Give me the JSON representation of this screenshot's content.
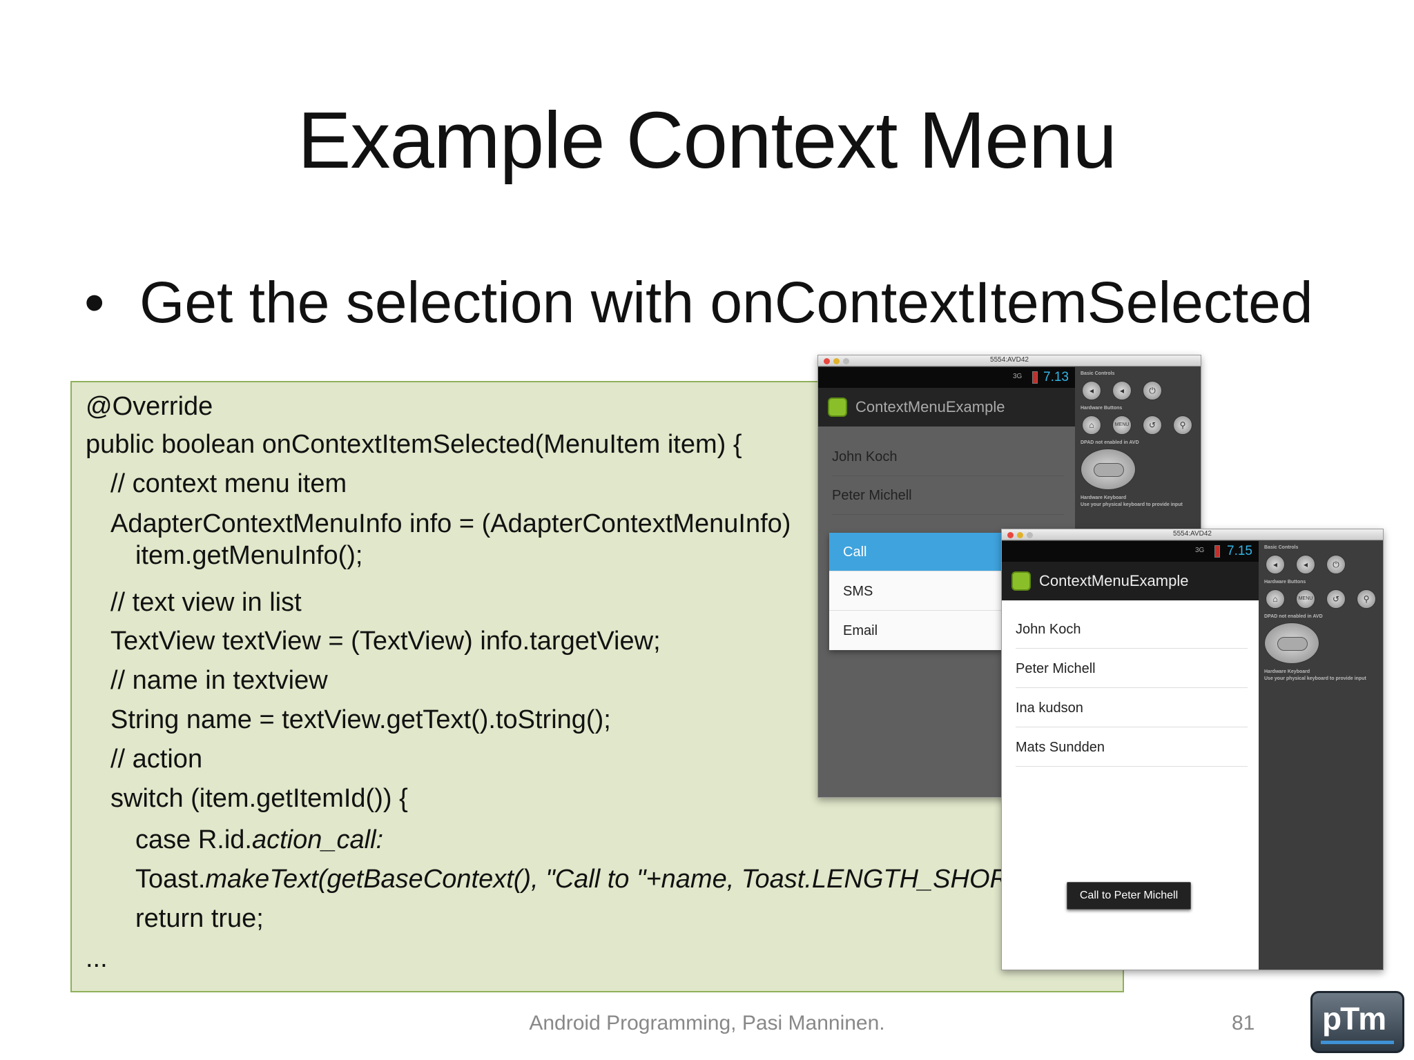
{
  "title": "Example Context Menu",
  "bullet": {
    "dot": "•",
    "text": "Get the selection with onContextItemSelected"
  },
  "code": [
    "@Override",
    "public boolean onContextItemSelected(MenuItem item) {",
    "// context menu item",
    "AdapterContextMenuInfo info = (AdapterContextMenuInfo)",
    "item.getMenuInfo();",
    "// text view in list",
    "TextView textView = (TextView) info.targetView;",
    "// name in textview",
    "String name = textView.getText().toString();",
    "// action",
    "switch (item.getItemId()) {",
    "case R.id.",
    "action_call:",
    "Toast.",
    "makeText(getBaseContext(), \"Call to \"+name, Toast.LENGTH_SHORT).sh",
    "return true;",
    "..."
  ],
  "emulator1": {
    "window_title": "5554:AVD42",
    "signal": "3G",
    "clock": "7.13",
    "app_title": "ContextMenuExample",
    "items": [
      "John Koch",
      "Peter Michell"
    ],
    "context_menu": [
      "Call",
      "SMS",
      "Email"
    ],
    "panel": {
      "basic_controls": "Basic Controls",
      "hardware_buttons": "Hardware Buttons",
      "menu_key": "MENU",
      "dpad": "DPAD not enabled in AVD",
      "keyboard": "Hardware Keyboard",
      "keyboard_hint": "Use your physical keyboard to provide input"
    }
  },
  "emulator2": {
    "window_title": "5554:AVD42",
    "signal": "3G",
    "clock": "7.15",
    "app_title": "ContextMenuExample",
    "items": [
      "John Koch",
      "Peter Michell",
      "Ina kudson",
      "Mats Sundden"
    ],
    "toast": "Call to Peter Michell",
    "panel": {
      "basic_controls": "Basic Controls",
      "hardware_buttons": "Hardware Buttons",
      "menu_key": "MENU",
      "dpad": "DPAD not enabled in AVD",
      "keyboard": "Hardware Keyboard",
      "keyboard_hint": "Use your physical keyboard to provide input"
    }
  },
  "footer": "Android Programming, Pasi Manninen.",
  "page_number": "81",
  "logo": "pTm"
}
